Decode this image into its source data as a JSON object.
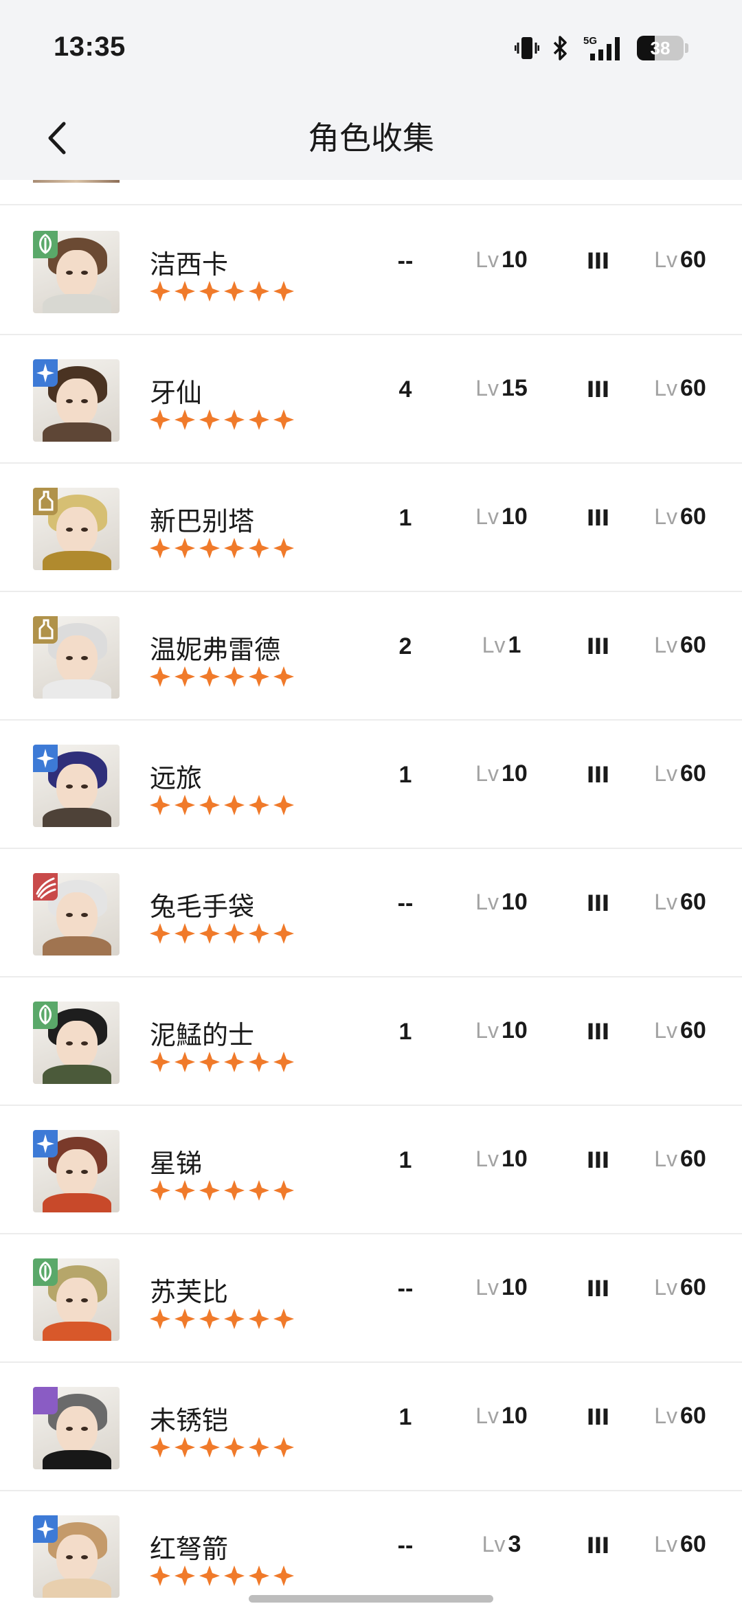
{
  "status_bar": {
    "time": "13:35",
    "network": "5G",
    "battery": "38",
    "battery_level": 0.38
  },
  "nav": {
    "title": "角色收集"
  },
  "colors": {
    "star": "#f07a2a",
    "badge_green": "#5aa869",
    "badge_blue": "#3d7ad6",
    "badge_gold": "#b0924a",
    "badge_red": "#c94a4a",
    "badge_purple": "#8a5cc4"
  },
  "lv_prefix": "Lv",
  "characters": [
    {
      "name": "洁西卡",
      "badge": "leaf-icon",
      "badge_color": "#5aa869",
      "stars": 6,
      "num": "--",
      "level": "10",
      "rank": "III",
      "level2": "60",
      "hair": "#6b4a33",
      "cloth": "#d8d8d2"
    },
    {
      "name": "牙仙",
      "badge": "star-compass-icon",
      "badge_color": "#3d7ad6",
      "stars": 6,
      "num": "4",
      "level": "15",
      "rank": "III",
      "level2": "60",
      "hair": "#4a3322",
      "cloth": "#5e4636"
    },
    {
      "name": "新巴别塔",
      "badge": "tower-icon",
      "badge_color": "#b0924a",
      "stars": 6,
      "num": "1",
      "level": "10",
      "rank": "III",
      "level2": "60",
      "hair": "#d6bf73",
      "cloth": "#b08a2e"
    },
    {
      "name": "温妮弗雷德",
      "badge": "tower-icon",
      "badge_color": "#b0924a",
      "stars": 6,
      "num": "2",
      "level": "1",
      "rank": "III",
      "level2": "60",
      "hair": "#dcdcdc",
      "cloth": "#eaeaea"
    },
    {
      "name": "远旅",
      "badge": "star-compass-icon",
      "badge_color": "#3d7ad6",
      "stars": 6,
      "num": "1",
      "level": "10",
      "rank": "III",
      "level2": "60",
      "hair": "#2f2f7a",
      "cloth": "#4e4238"
    },
    {
      "name": "兔毛手袋",
      "badge": "claw-icon",
      "badge_color": "#c94a4a",
      "stars": 6,
      "num": "--",
      "level": "10",
      "rank": "III",
      "level2": "60",
      "hair": "#e4e4e4",
      "cloth": "#a07450"
    },
    {
      "name": "泥鯭的士",
      "badge": "leaf-icon",
      "badge_color": "#5aa869",
      "stars": 6,
      "num": "1",
      "level": "10",
      "rank": "III",
      "level2": "60",
      "hair": "#1e1e1e",
      "cloth": "#4b5a3a"
    },
    {
      "name": "星锑",
      "badge": "star-compass-icon",
      "badge_color": "#3d7ad6",
      "stars": 6,
      "num": "1",
      "level": "10",
      "rank": "III",
      "level2": "60",
      "hair": "#7a3a2a",
      "cloth": "#c8492a"
    },
    {
      "name": "苏芙比",
      "badge": "leaf-icon",
      "badge_color": "#5aa869",
      "stars": 6,
      "num": "--",
      "level": "10",
      "rank": "III",
      "level2": "60",
      "hair": "#b6a66a",
      "cloth": "#d8582a"
    },
    {
      "name": "未锈铠",
      "badge": "moon-icon",
      "badge_color": "#8a5cc4",
      "stars": 6,
      "num": "1",
      "level": "10",
      "rank": "III",
      "level2": "60",
      "hair": "#6a6a6a",
      "cloth": "#181818"
    },
    {
      "name": "红弩箭",
      "badge": "star-compass-icon",
      "badge_color": "#3d7ad6",
      "stars": 6,
      "num": "--",
      "level": "3",
      "rank": "III",
      "level2": "60",
      "hair": "#c49a6a",
      "cloth": "#e8cfae"
    }
  ]
}
